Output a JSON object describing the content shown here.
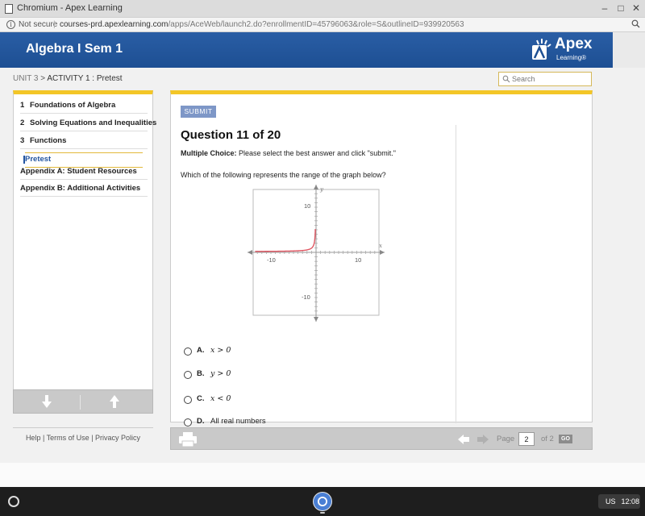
{
  "window": {
    "title": "Chromium - Apex Learning",
    "minimize": "–",
    "maximize": "□",
    "close": "✕"
  },
  "address_bar": {
    "security": "Not secure",
    "separator": "|",
    "url_host": "courses-prd.apexlearning.com",
    "url_path": "/apps/AceWeb/launch2.do?enrollmentID=45796063&role=S&outlineID=939920563"
  },
  "header": {
    "course_title": "Algebra I Sem 1",
    "logo_name": "Apex",
    "logo_sub": "Learning®"
  },
  "breadcrumb": {
    "unit": "UNIT 3",
    "separator": " > ",
    "activity": "ACTIVITY 1 : Pretest"
  },
  "search": {
    "placeholder": "Search"
  },
  "nav": {
    "items": [
      {
        "num": "1",
        "label": "Foundations of Algebra"
      },
      {
        "num": "2",
        "label": "Solving Equations and Inequalities"
      },
      {
        "num": "3",
        "label": "Functions"
      },
      {
        "num": "",
        "label": "Pretest"
      },
      {
        "num": "",
        "label": "Appendix A: Student Resources"
      },
      {
        "num": "",
        "label": "Appendix B: Additional Activities"
      }
    ],
    "active_index": 3
  },
  "footer_links": {
    "help": "Help",
    "terms": "Terms of Use",
    "privacy": "Privacy Policy",
    "sep": "|"
  },
  "question": {
    "submit_label": "SUBMIT",
    "title": "Question 11 of 20",
    "type_label": "Multiple Choice:",
    "type_instructions": "Please select the best answer and click \"submit.\"",
    "prompt": "Which of the following represents the range of the graph below?",
    "graph": {
      "x_axis_label": "x",
      "y_axis_label": "y",
      "ticks_shown": {
        "x_neg": "-10",
        "x_pos": "10",
        "y_pos": "10",
        "y_neg": "-10"
      },
      "curve": "exponential-like, approaching y = 0 as x → -∞ and rising steeply near x = 0",
      "curve_color": "#e05561"
    },
    "choices": [
      {
        "letter": "A.",
        "text": "x > 0"
      },
      {
        "letter": "B.",
        "text": "y > 0"
      },
      {
        "letter": "C.",
        "text": "x < 0"
      },
      {
        "letter": "D.",
        "text": "All real numbers"
      }
    ]
  },
  "pager": {
    "page_label": "Page",
    "current_page": "2",
    "of_label": "of 2",
    "go_label": "GO"
  },
  "shelf": {
    "language": "US",
    "time": "12:08"
  },
  "colors": {
    "header_blue": "#1d4f93",
    "accent_yellow": "#f3c627",
    "submit_blue": "#7e97c7"
  }
}
